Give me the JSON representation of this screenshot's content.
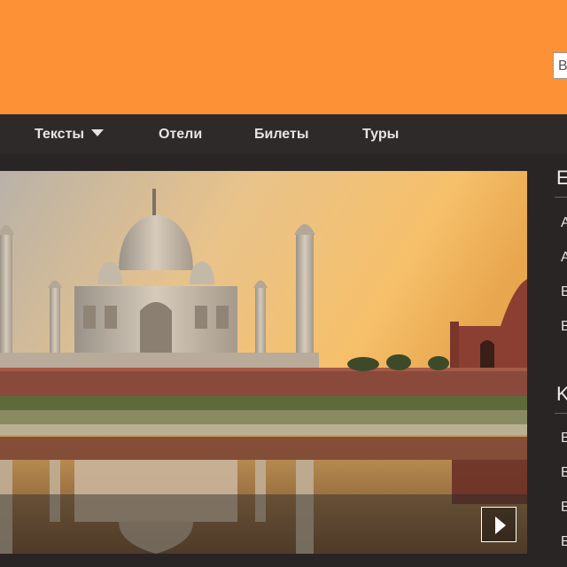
{
  "colors": {
    "header_bg": "#fc9136",
    "nav_bg": "#2f2a2a",
    "content_bg": "#2a2525"
  },
  "search": {
    "visible_text": "B"
  },
  "nav": {
    "items": [
      {
        "label": "Тексты",
        "has_dropdown": true,
        "icon": "caret-down-icon"
      },
      {
        "label": "Отели"
      },
      {
        "label": "Билеты"
      },
      {
        "label": "Туры"
      }
    ]
  },
  "slider": {
    "play_icon": "play-icon"
  },
  "sidebar": {
    "sections": [
      {
        "title": "E",
        "items": [
          "A",
          "A",
          "B",
          "B"
        ]
      },
      {
        "title": "K",
        "items": [
          "B",
          "B",
          "B",
          "B"
        ]
      }
    ]
  }
}
